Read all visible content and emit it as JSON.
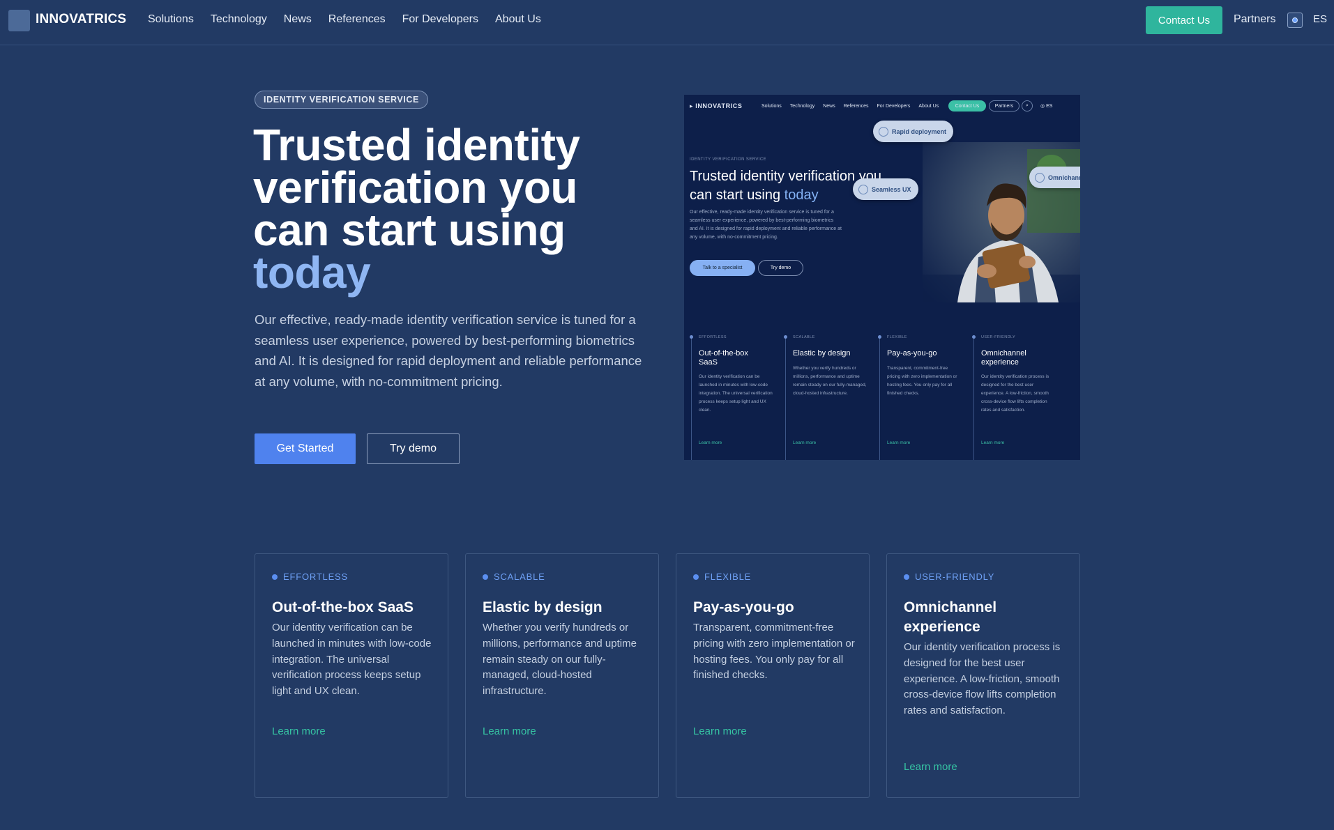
{
  "nav": {
    "brand": "INNOVATRICS",
    "links": [
      "Solutions",
      "Technology",
      "News",
      "References",
      "For Developers",
      "About Us"
    ],
    "contact": "Contact Us",
    "partners": "Partners",
    "lang": "ES"
  },
  "hero": {
    "badge": "IDENTITY VERIFICATION SERVICE",
    "title_line1": "Trusted identity",
    "title_line2": "verification you",
    "title_line3": "can start using",
    "title_highlight": "today",
    "description": "Our effective, ready-made identity verification service is tuned for a seamless user experience, powered by best-performing biometrics and AI. It is designed for rapid deployment and reliable performance at any volume, with no-commitment pricing.",
    "primary_button": "Get Started",
    "secondary_button": "Try demo"
  },
  "preview": {
    "logo": "INNOVATRICS",
    "links": [
      "Solutions",
      "Technology",
      "News",
      "References",
      "For Developers",
      "About Us"
    ],
    "contact": "Contact Us",
    "partners": "Partners",
    "lang": "ES",
    "tag": "IDENTITY VERIFICATION SERVICE",
    "title_main": "Trusted identity verification you can start using",
    "title_highlight": "today",
    "description": "Our effective, ready-made identity verification service is tuned for a seamless user experience, powered by best-performing biometrics and AI. It is designed for rapid deployment and reliable performance at any volume, with no-commitment pricing.",
    "btn_primary": "Talk to a specialist",
    "btn_secondary": "Try demo",
    "pill_rapid": "Rapid deployment",
    "pill_seamless": "Seamless UX",
    "pill_omni": "Omnichannel",
    "columns": [
      {
        "tag": "EFFORTLESS",
        "title": "Out-of-the-box SaaS",
        "desc": "Our identity verification can be launched in minutes with low-code integration. The universal verification process keeps setup light and UX clean.",
        "more": "Learn more"
      },
      {
        "tag": "SCALABLE",
        "title": "Elastic by design",
        "desc": "Whether you verify hundreds or millions, performance and uptime remain steady on our fully-managed, cloud-hosted infrastructure.",
        "more": "Learn more"
      },
      {
        "tag": "FLEXIBLE",
        "title": "Pay-as-you-go",
        "desc": "Transparent, commitment-free pricing with zero implementation or hosting fees. You only pay for all finished checks.",
        "more": "Learn more"
      },
      {
        "tag": "USER-FRIENDLY",
        "title": "Omnichannel experience",
        "desc": "Our identity verification process is designed for the best user experience. A low-friction, smooth cross-device flow lifts completion rates and satisfaction.",
        "more": "Learn more"
      }
    ]
  },
  "cards": [
    {
      "tag": "EFFORTLESS",
      "title": "Out-of-the-box SaaS",
      "desc": "Our identity verification can be launched in minutes with low-code integration. The universal verification process keeps setup light and UX clean.",
      "more": "Learn more"
    },
    {
      "tag": "SCALABLE",
      "title": "Elastic by design",
      "desc": "Whether you verify hundreds or millions, performance and uptime remain steady on our fully-managed, cloud-hosted infrastructure.",
      "more": "Learn more"
    },
    {
      "tag": "FLEXIBLE",
      "title": "Pay-as-you-go",
      "desc": "Transparent, commitment-free pricing with zero implementation or hosting fees. You only pay for all finished checks.",
      "more": "Learn more"
    },
    {
      "tag": "USER-FRIENDLY",
      "title": "Omnichannel experience",
      "desc": "Our identity verification process is designed for the best user experience. A low-friction, smooth cross-device flow lifts completion rates and satisfaction.",
      "more": "Learn more"
    }
  ],
  "colors": {
    "background": "#223a64",
    "accent_blue": "#4f82ee",
    "accent_green": "#2fb59d",
    "highlight_text": "#8fb6f3"
  }
}
